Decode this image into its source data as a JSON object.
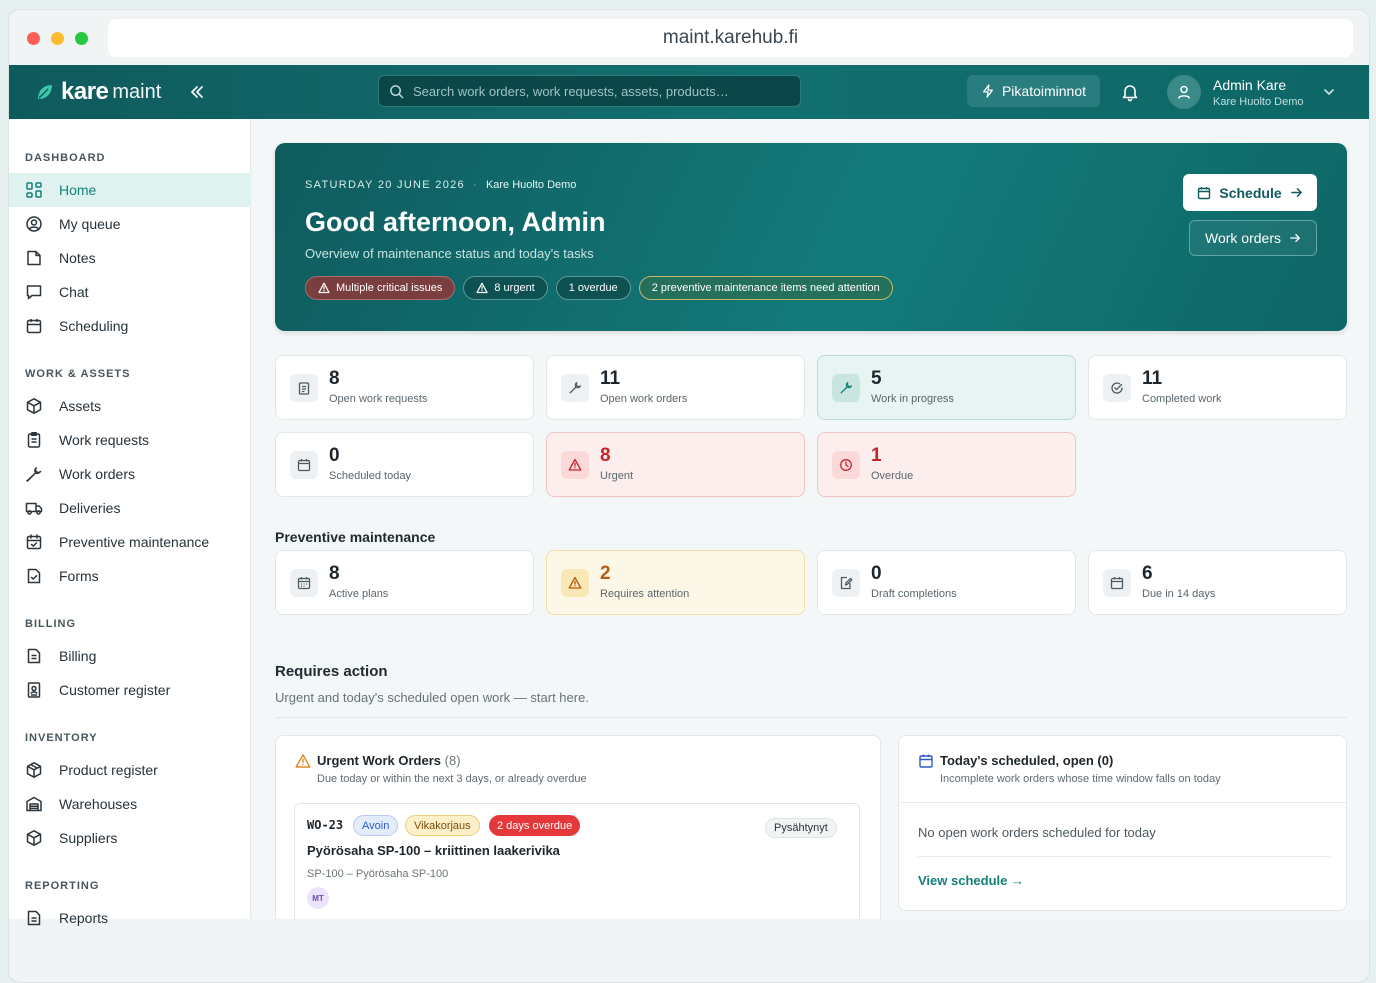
{
  "browser": {
    "url": "maint.karehub.fi"
  },
  "topbar": {
    "logo_kare": "kare",
    "logo_maint": "maint",
    "search_placeholder": "Search work orders, work requests, assets, products…",
    "quick_actions": "Pikatoiminnot",
    "user_name": "Admin Kare",
    "user_org": "Kare Huolto Demo"
  },
  "sidebar": {
    "sections": [
      {
        "title": "DASHBOARD",
        "items": [
          {
            "label": "Home",
            "icon": "grid-icon"
          },
          {
            "label": "My queue",
            "icon": "user-circle-icon"
          },
          {
            "label": "Notes",
            "icon": "note-icon"
          },
          {
            "label": "Chat",
            "icon": "chat-icon"
          },
          {
            "label": "Scheduling",
            "icon": "calendar-icon"
          }
        ]
      },
      {
        "title": "WORK & ASSETS",
        "items": [
          {
            "label": "Assets",
            "icon": "box-icon"
          },
          {
            "label": "Work requests",
            "icon": "clipboard-icon"
          },
          {
            "label": "Work orders",
            "icon": "wrench-icon"
          },
          {
            "label": "Deliveries",
            "icon": "truck-icon"
          },
          {
            "label": "Preventive maintenance",
            "icon": "calendar-check-icon"
          },
          {
            "label": "Forms",
            "icon": "form-icon"
          }
        ]
      },
      {
        "title": "BILLING",
        "items": [
          {
            "label": "Billing",
            "icon": "invoice-icon"
          },
          {
            "label": "Customer register",
            "icon": "contact-book-icon"
          }
        ]
      },
      {
        "title": "INVENTORY",
        "items": [
          {
            "label": "Product register",
            "icon": "package-icon"
          },
          {
            "label": "Warehouses",
            "icon": "warehouse-icon"
          },
          {
            "label": "Suppliers",
            "icon": "supplier-box-icon"
          }
        ]
      },
      {
        "title": "REPORTING",
        "items": [
          {
            "label": "Reports",
            "icon": "report-icon"
          }
        ]
      }
    ],
    "active": "Home"
  },
  "hero": {
    "date": "SATURDAY 20 JUNE 2026",
    "org": "Kare Huolto Demo",
    "greeting": "Good afternoon, Admin",
    "subtitle": "Overview of maintenance status and today's tasks",
    "pills": {
      "critical": "Multiple critical issues",
      "urgent": "8 urgent",
      "overdue": "1 overdue",
      "pm": "2 preventive maintenance items need attention"
    },
    "schedule_btn": "Schedule",
    "work_orders_btn": "Work orders"
  },
  "stats": {
    "open_requests": {
      "value": "8",
      "label": "Open work requests"
    },
    "open_orders": {
      "value": "11",
      "label": "Open work orders"
    },
    "in_progress": {
      "value": "5",
      "label": "Work in progress"
    },
    "completed": {
      "value": "11",
      "label": "Completed work"
    },
    "scheduled_today": {
      "value": "0",
      "label": "Scheduled today"
    },
    "urgent": {
      "value": "8",
      "label": "Urgent"
    },
    "overdue": {
      "value": "1",
      "label": "Overdue"
    }
  },
  "preventive": {
    "title": "Preventive maintenance",
    "active_plans": {
      "value": "8",
      "label": "Active plans"
    },
    "requires_attention": {
      "value": "2",
      "label": "Requires attention"
    },
    "draft_completions": {
      "value": "0",
      "label": "Draft completions"
    },
    "due_14": {
      "value": "6",
      "label": "Due in 14 days"
    }
  },
  "requires_action": {
    "title": "Requires action",
    "subtitle": "Urgent and today's scheduled open work — start here.",
    "urgent_panel": {
      "title": "Urgent Work Orders",
      "count": "(8)",
      "subtitle": "Due today or within the next 3 days, or already overdue",
      "item": {
        "id": "WO-23",
        "status": "Avoin",
        "type": "Vikakorjaus",
        "overdue": "2 days overdue",
        "state": "Pysähtynyt",
        "title": "Pyörösaha SP-100 – kriittinen laakerivika",
        "asset": "SP-100 – Pyörösaha SP-100",
        "assignee": "MT"
      }
    },
    "today_panel": {
      "title": "Today's scheduled, open (0)",
      "subtitle": "Incomplete work orders whose time window falls on today",
      "empty": "No open work orders scheduled for today",
      "link": "View schedule →"
    }
  },
  "colors": {
    "brand": "#137070",
    "accent": "#13807a",
    "danger": "#e5383b",
    "warning": "#f1dfa6"
  }
}
